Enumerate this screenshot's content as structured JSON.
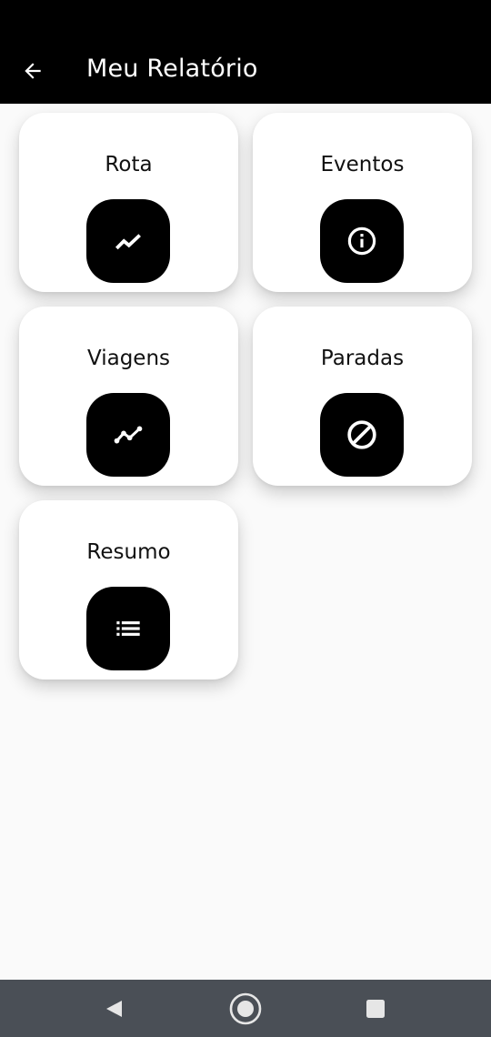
{
  "appbar": {
    "title": "Meu Relatório",
    "back_icon": "arrow-back-icon"
  },
  "cards": [
    {
      "label": "Rota",
      "icon": "trending-up-icon"
    },
    {
      "label": "Eventos",
      "icon": "info-icon"
    },
    {
      "label": "Viagens",
      "icon": "multiline-chart-icon"
    },
    {
      "label": "Paradas",
      "icon": "block-icon"
    },
    {
      "label": "Resumo",
      "icon": "list-icon"
    }
  ],
  "navbar": {
    "icons": [
      "nav-back-icon",
      "nav-home-icon",
      "nav-recents-icon"
    ]
  },
  "colors": {
    "appbar_bg": "#000000",
    "page_bg": "#fafafa",
    "card_bg": "#ffffff",
    "icon_tile_bg": "#000000",
    "navbar_bg": "#4a4f56"
  }
}
